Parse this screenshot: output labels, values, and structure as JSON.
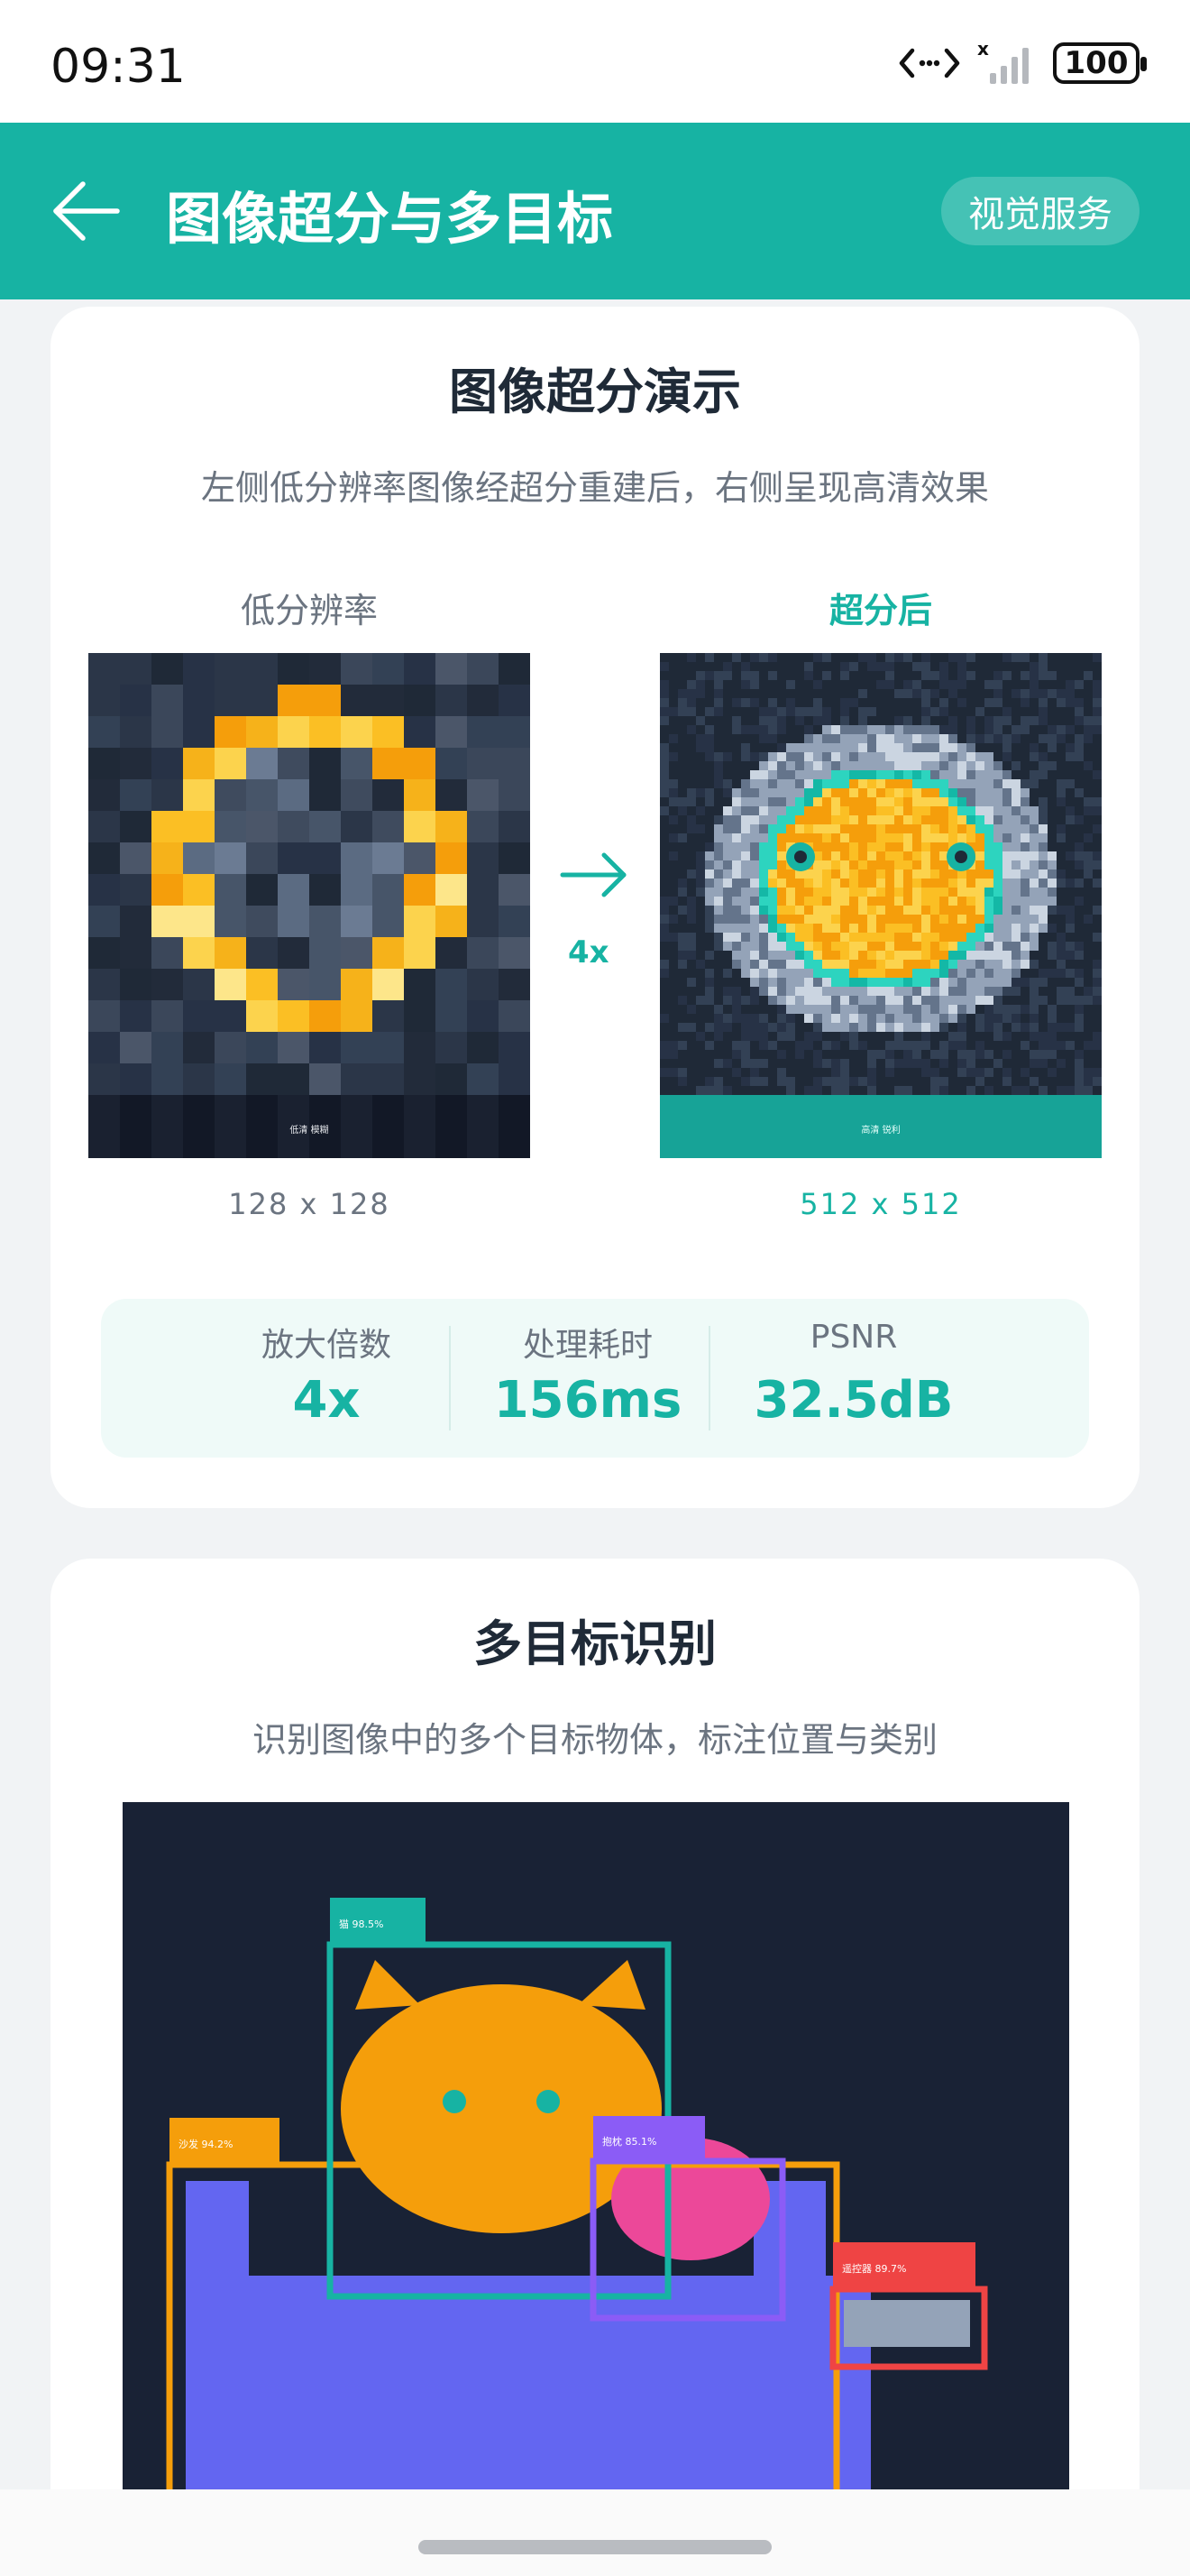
{
  "status_bar": {
    "time": "09:31",
    "battery": "100"
  },
  "app_bar": {
    "title": "图像超分与多目标",
    "chip": "视觉服务"
  },
  "super_resolution": {
    "title": "图像超分演示",
    "subtitle": "左侧低分辨率图像经超分重建后，右侧呈现高清效果",
    "low_label": "低分辨率",
    "high_label": "超分后",
    "low_caption": "低清 模糊",
    "high_caption": "高清 锐利",
    "low_res": "128 x 128",
    "high_res": "512 x 512",
    "scale_label": "4x",
    "stats": [
      {
        "label": "放大倍数",
        "value": "4x"
      },
      {
        "label": "处理耗时",
        "value": "156ms"
      },
      {
        "label": "PSNR",
        "value": "32.5dB"
      }
    ]
  },
  "detection": {
    "title": "多目标识别",
    "subtitle": "识别图像中的多个目标物体，标注位置与类别",
    "boxes": [
      {
        "label": "猫 98.5%",
        "color": "#17b3a3"
      },
      {
        "label": "沙发 94.2%",
        "color": "#f59e0b"
      },
      {
        "label": "抱枕 85.1%",
        "color": "#8b5cf6"
      },
      {
        "label": "遥控器 89.7%",
        "color": "#ef4444"
      }
    ]
  },
  "colors": {
    "accent": "#17b3a3",
    "orange": "#f59e0b",
    "purple": "#8b5cf6",
    "red": "#ef4444",
    "indigo": "#6366f1",
    "pink": "#ec4899"
  }
}
